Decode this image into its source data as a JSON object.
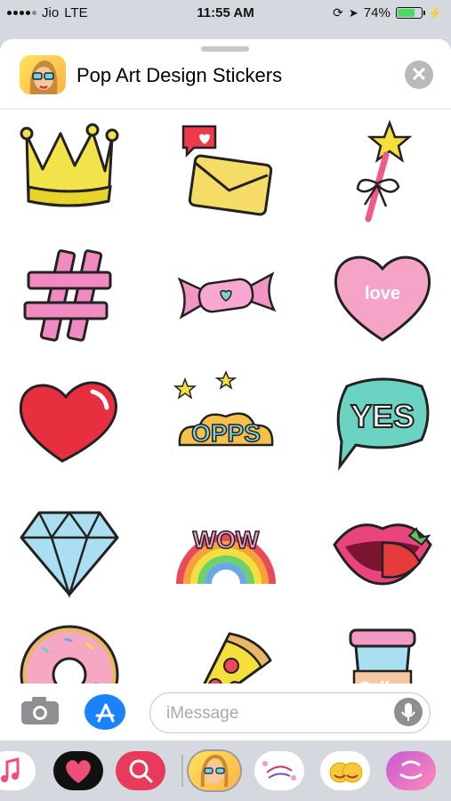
{
  "status": {
    "carrier": "Jio",
    "network": "LTE",
    "time": "11:55 AM",
    "battery_text": "74%",
    "battery_level": 0.74
  },
  "header": {
    "title": "Pop Art Design Stickers",
    "close_label": "✕"
  },
  "stickers": [
    {
      "name": "crown"
    },
    {
      "name": "love-letter"
    },
    {
      "name": "magic-wand"
    },
    {
      "name": "hashtag"
    },
    {
      "name": "candy"
    },
    {
      "name": "love-heart",
      "text": "love"
    },
    {
      "name": "red-heart"
    },
    {
      "name": "opps-cloud",
      "text": "OPPS"
    },
    {
      "name": "yes-bubble",
      "text": "YES"
    },
    {
      "name": "diamond"
    },
    {
      "name": "wow-rainbow",
      "text": "WOW"
    },
    {
      "name": "lips-strawberry"
    },
    {
      "name": "donut"
    },
    {
      "name": "pizza"
    },
    {
      "name": "coffee-cup",
      "text": "Coffee"
    }
  ],
  "compose": {
    "placeholder": "iMessage"
  },
  "tray_apps": [
    "music",
    "digital-touch",
    "images-search",
    "pop-art-stickers",
    "beautiful-day-stickers",
    "emoji-stickers",
    "cool-dude-stickers"
  ],
  "colors": {
    "accent": "#1a82fb",
    "battery": "#4cd964"
  }
}
